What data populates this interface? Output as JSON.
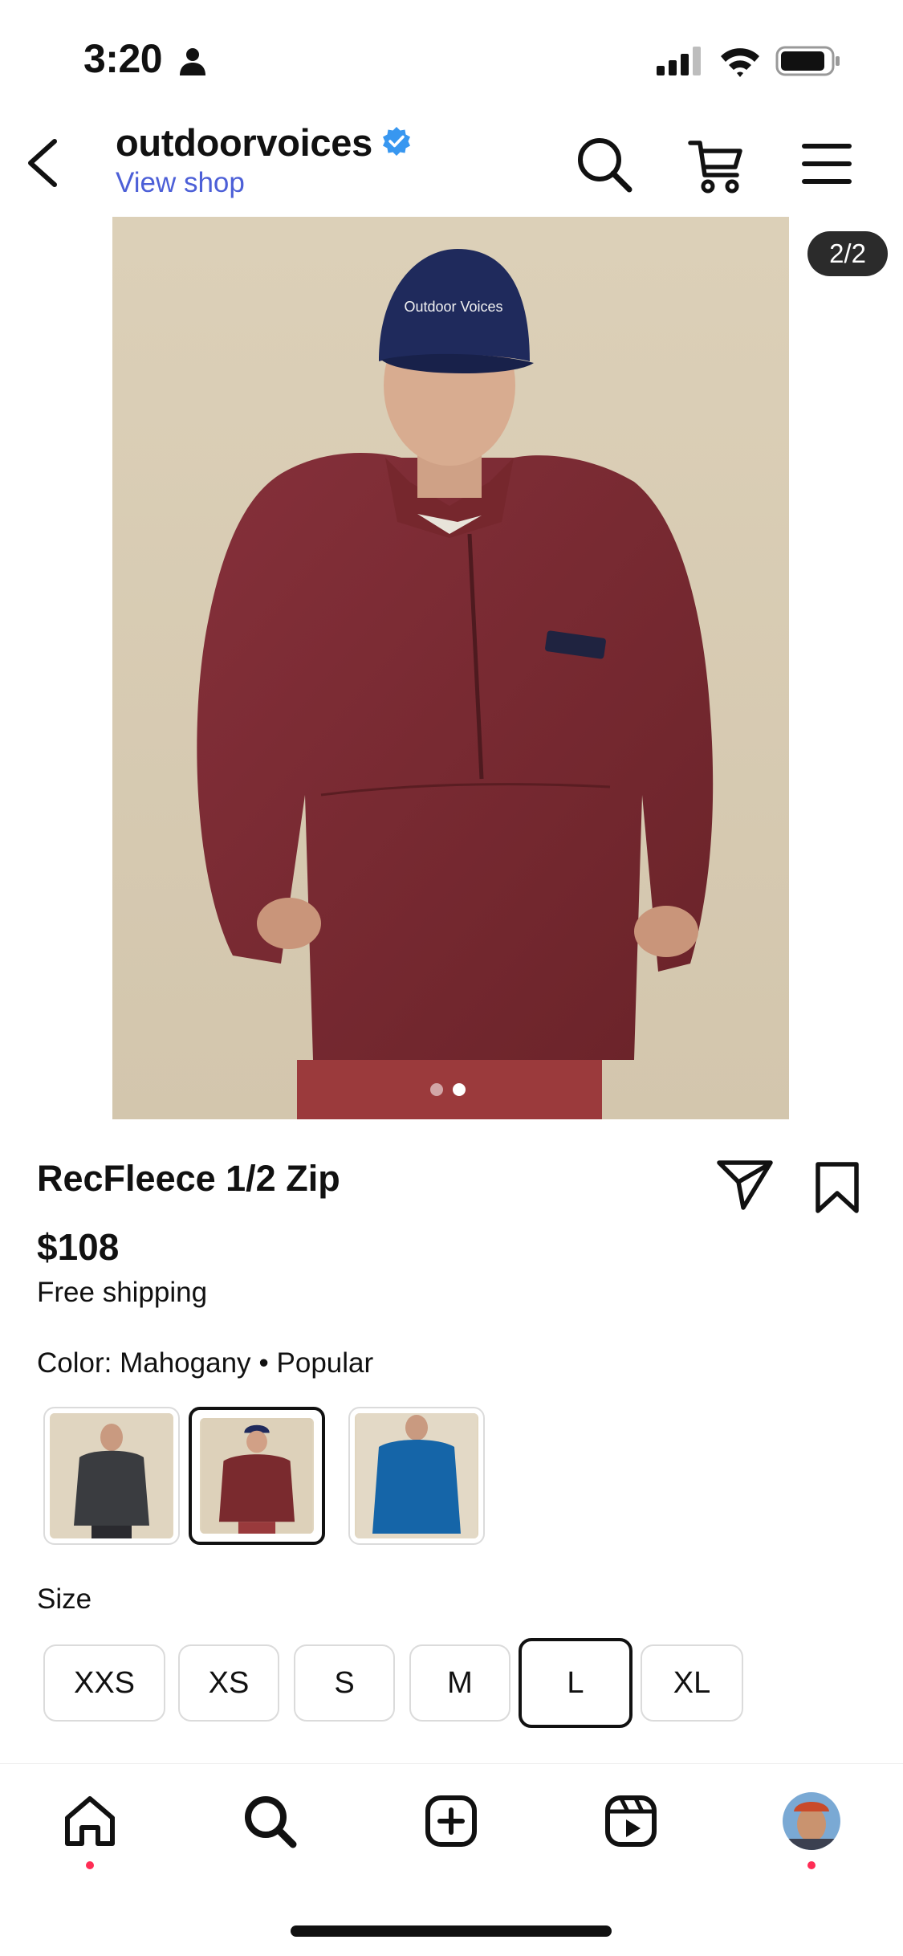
{
  "status_bar": {
    "time": "3:20",
    "icons": [
      "person-icon",
      "signal-icon",
      "wifi-icon",
      "battery-icon"
    ]
  },
  "header": {
    "shop_name": "outdoorvoices",
    "view_shop": "View shop",
    "icons": [
      "back-icon",
      "verified-icon",
      "search-icon",
      "cart-icon",
      "menu-icon"
    ],
    "verified_color": "#3897f0",
    "link_color": "#4c5fd7"
  },
  "gallery": {
    "page_indicator": "2/2",
    "current_index": 2,
    "total": 2,
    "cap_text": "Outdoor Voices",
    "patch_text": "Outdoor Voices",
    "product_color": "#7a2a2e"
  },
  "product": {
    "title": "RecFleece 1/2 Zip",
    "price": "$108",
    "shipping": "Free shipping",
    "color_label": "Color: Mahogany",
    "color_tag": "• Popular",
    "swatches": [
      {
        "name": "Charcoal",
        "color": "#3a3c40",
        "selected": false
      },
      {
        "name": "Mahogany",
        "color": "#7a2a2e",
        "selected": true
      },
      {
        "name": "Blue",
        "color": "#1565a8",
        "selected": false
      }
    ],
    "size_label": "Size",
    "sizes": [
      "XXS",
      "XS",
      "S",
      "M",
      "L",
      "XL"
    ],
    "selected_size": "L"
  },
  "bottom_nav": {
    "items": [
      "home-icon",
      "explore-icon",
      "create-icon",
      "reels-icon",
      "profile-avatar"
    ],
    "active": "home",
    "notification_color": "#ff2d55"
  }
}
